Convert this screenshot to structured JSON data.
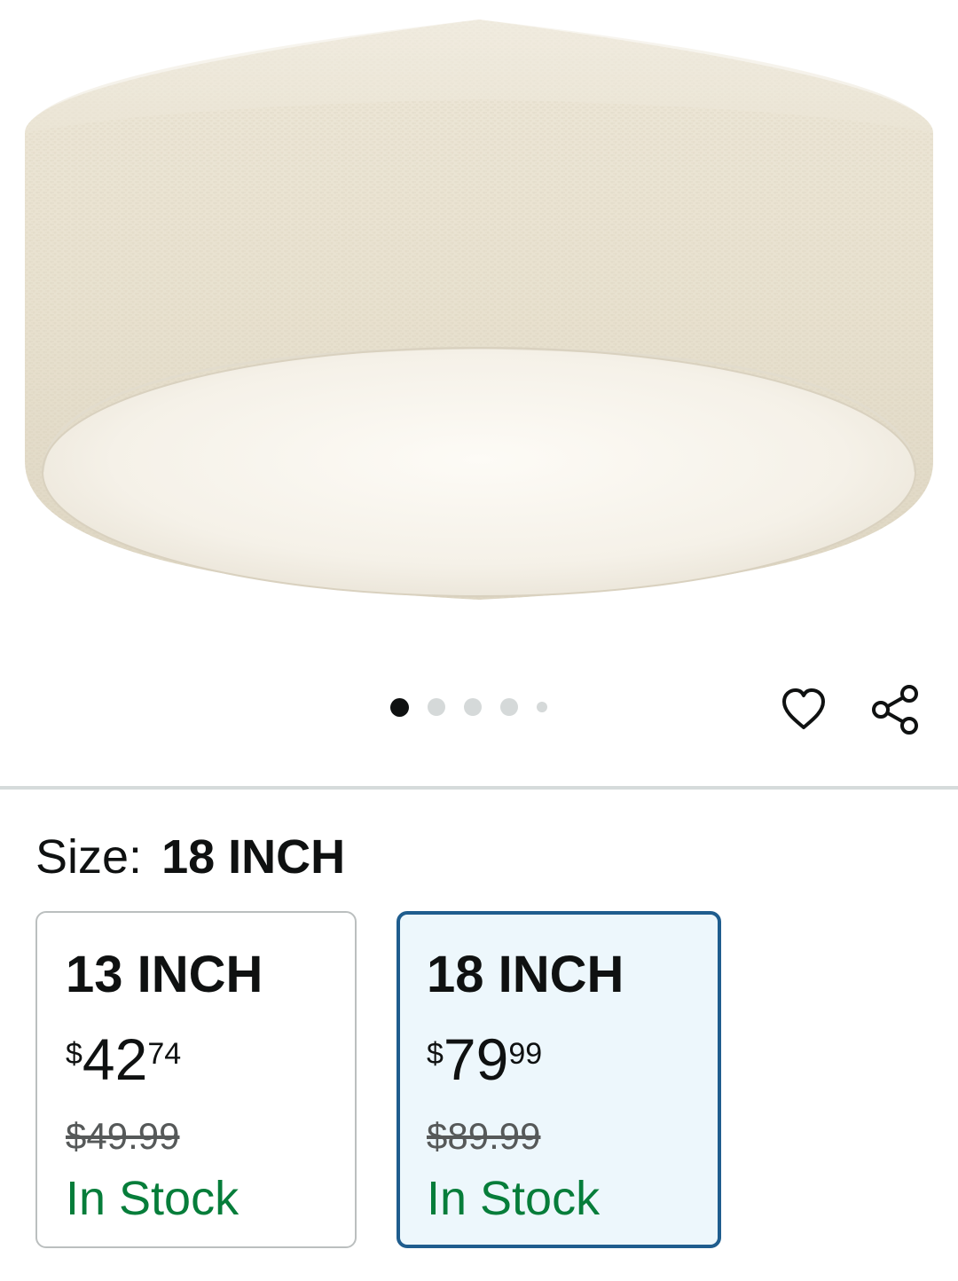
{
  "carousel": {
    "image_alt": "Round drum flush mount ceiling light with beige linen shade and white diffuser",
    "total_dots": 5,
    "active_index": 0
  },
  "actions": {
    "wishlist_icon": "heart-outline-icon",
    "share_icon": "share-icon"
  },
  "size_selector": {
    "label": "Size:",
    "selected_value": "18 INCH",
    "options": [
      {
        "name": "13 INCH",
        "currency": "$",
        "price_whole": "42",
        "price_fraction": "74",
        "list_price": "$49.99",
        "availability": "In Stock",
        "selected": false
      },
      {
        "name": "18 INCH",
        "currency": "$",
        "price_whole": "79",
        "price_fraction": "99",
        "list_price": "$89.99",
        "availability": "In Stock",
        "selected": true
      }
    ]
  },
  "colors": {
    "text": "#0f1111",
    "stock_green": "#067d3a",
    "selected_border": "#1f5d8e",
    "selected_bg": "#edf7fc",
    "list_price_gray": "#565959",
    "divider": "#d5dbdb"
  }
}
